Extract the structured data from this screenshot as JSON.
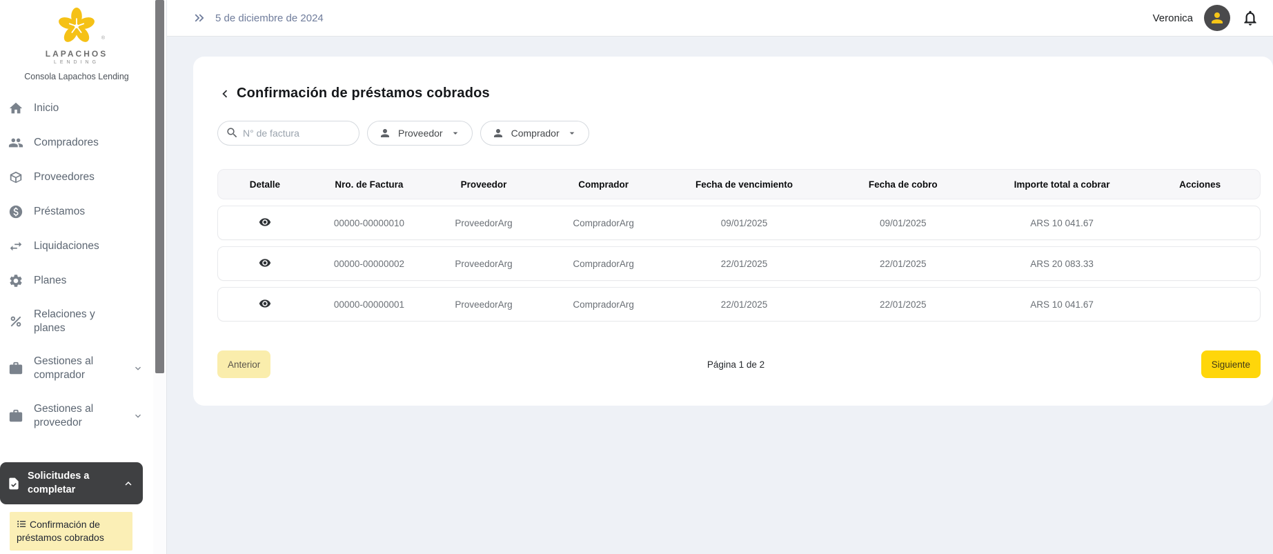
{
  "brand": {
    "logo_word": "LAPACHOS",
    "logo_sub": "LENDING",
    "registered_mark": "®",
    "console_title": "Consola Lapachos Lending",
    "flower_color": "#F5C116"
  },
  "sidebar": {
    "items": [
      {
        "icon": "home-icon",
        "label": "Inicio"
      },
      {
        "icon": "buyers-people-icon",
        "label": "Compradores"
      },
      {
        "icon": "package-cube-icon",
        "label": "Proveedores"
      },
      {
        "icon": "coin-dollar-icon",
        "label": "Préstamos"
      },
      {
        "icon": "swap-arrows-icon",
        "label": "Liquidaciones"
      },
      {
        "icon": "gear-icon",
        "label": "Planes"
      },
      {
        "icon": "percent-icon",
        "label": "Relaciones y planes"
      },
      {
        "icon": "briefcase-icon",
        "label": "Gestiones al comprador",
        "expandable": true
      },
      {
        "icon": "briefcase-icon",
        "label": "Gestiones al proveedor",
        "expandable": true
      }
    ],
    "solicitudes": {
      "icon": "document-check-icon",
      "label": "Solicitudes a completar"
    },
    "active_submenu": {
      "icon": "checklist-icon",
      "label": "Confirmación de préstamos cobrados"
    }
  },
  "topbar": {
    "date": "5 de diciembre de 2024",
    "user_name": "Veronica"
  },
  "page": {
    "title": "Confirmación de préstamos cobrados"
  },
  "filters": {
    "search_placeholder": "N° de factura",
    "proveedor_label": "Proveedor",
    "comprador_label": "Comprador"
  },
  "table": {
    "headers": [
      "Detalle",
      "Nro. de Factura",
      "Proveedor",
      "Comprador",
      "Fecha de vencimiento",
      "Fecha de cobro",
      "Importe total a cobrar",
      "Acciones"
    ],
    "rows": [
      {
        "invoice": "00000-00000010",
        "proveedor": "ProveedorArg",
        "comprador": "CompradorArg",
        "vencimiento": "09/01/2025",
        "cobro": "09/01/2025",
        "importe": "ARS 10 041.67"
      },
      {
        "invoice": "00000-00000002",
        "proveedor": "ProveedorArg",
        "comprador": "CompradorArg",
        "vencimiento": "22/01/2025",
        "cobro": "22/01/2025",
        "importe": "ARS 20 083.33"
      },
      {
        "invoice": "00000-00000001",
        "proveedor": "ProveedorArg",
        "comprador": "CompradorArg",
        "vencimiento": "22/01/2025",
        "cobro": "22/01/2025",
        "importe": "ARS 10 041.67"
      }
    ]
  },
  "pagination": {
    "prev_label": "Anterior",
    "page_info": "Página 1 de 2",
    "next_label": "Siguiente"
  },
  "colors": {
    "accent_yellow": "#FFD60A",
    "pale_yellow": "#FBEFB6",
    "dark_menu": "#3F4042",
    "content_bg": "#EEF1F6",
    "slate_text": "#6F7C9B"
  }
}
